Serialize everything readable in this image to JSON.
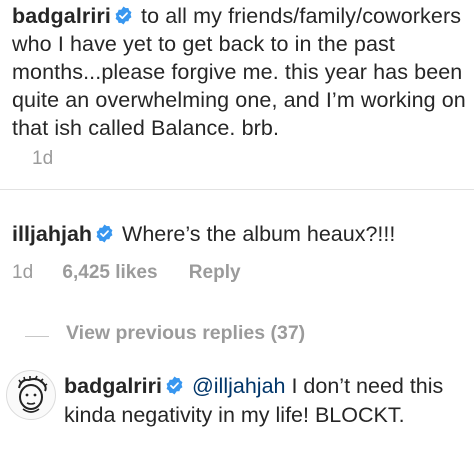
{
  "post_caption": {
    "username": "badgalriri",
    "text_line1": "to all my friends/family/coworkers",
    "text_rest": "who I have yet to get back to in the past\nmonths...please forgive me. this year has been\nquite an overwhelming one, and I’m working on\nthat ish called Balance. brb.",
    "time": "1d"
  },
  "comment": {
    "username": "illjahjah",
    "text": "Where’s the album heaux?!!!",
    "time": "1d",
    "likes": "6,425 likes",
    "reply_label": "Reply"
  },
  "view_replies": "View previous replies (37)",
  "reply": {
    "username": "badgalriri",
    "mention": "@illjahjah",
    "text": "I don’t need this kinda negativity in my life! BLOCKT."
  },
  "colors": {
    "text": "#262626",
    "meta": "#9b9b9b",
    "verified": "#3897f0",
    "mention": "#003569"
  },
  "icons": {
    "verified": "verified-badge-icon",
    "avatar": "profile-avatar-sketch"
  }
}
